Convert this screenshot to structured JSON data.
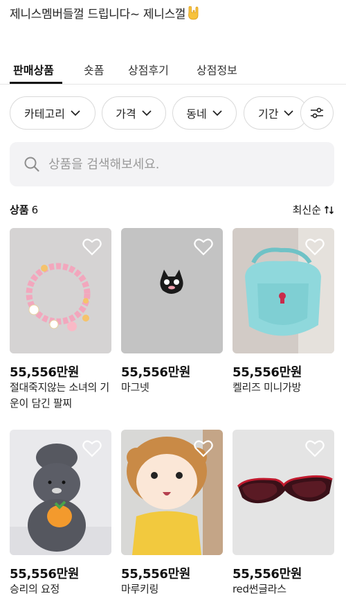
{
  "shop": {
    "intro": "제니스멤버들껄 드립니다~ 제니스껄"
  },
  "tabs": [
    {
      "label": "판매상품",
      "active": true
    },
    {
      "label": "숏폼",
      "active": false
    },
    {
      "label": "상점후기",
      "active": false
    },
    {
      "label": "상점정보",
      "active": false
    }
  ],
  "filters": [
    {
      "label": "카테고리",
      "icon": "chevron-down-icon"
    },
    {
      "label": "가격",
      "icon": "chevron-down-icon"
    },
    {
      "label": "동네",
      "icon": "chevron-down-icon"
    },
    {
      "label": "기간",
      "icon": "chevron-down-icon"
    }
  ],
  "search": {
    "placeholder": "상품을 검색해보세요.",
    "value": ""
  },
  "products_header": {
    "label": "상품",
    "count": "6",
    "sort_label": "최신순",
    "sort_icon": "sort-arrows-icon"
  },
  "products": [
    {
      "price": "55,556만원",
      "name": "절대죽지않는 소녀의 기운이 담긴 팔찌",
      "image": "pink-bead-bracelet"
    },
    {
      "price": "55,556만원",
      "name": "마그넷",
      "image": "black-cat-magnet"
    },
    {
      "price": "55,556만원",
      "name": "켈리즈 미니가방",
      "image": "mint-mini-bag"
    },
    {
      "price": "55,556만원",
      "name": "승리의 요정",
      "image": "gray-plush-with-carrot"
    },
    {
      "price": "55,556만원",
      "name": "마루키링",
      "image": "doll-keyring"
    },
    {
      "price": "55,556만원",
      "name": "red썬글라스",
      "image": "red-sunglasses"
    }
  ],
  "colors": {
    "text": "#111111",
    "chip_border": "#d9d9d9",
    "search_bg": "#f3f3f5",
    "mint_bag": "#7fd3d6"
  }
}
